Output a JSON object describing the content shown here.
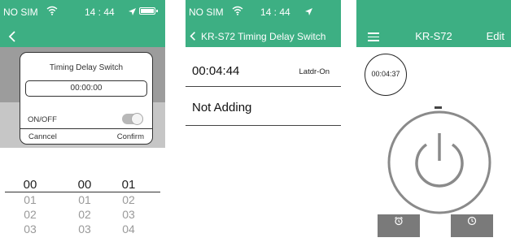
{
  "panel1": {
    "status": {
      "carrier": "NO SIM",
      "time": "14 : 44"
    },
    "dialog": {
      "title": "Timing Delay Switch",
      "time_value": "00:00:00",
      "onoff_label": "ON/OFF",
      "toggle_on": false,
      "cancel_label": "Canncel",
      "confirm_label": "Confirm"
    },
    "pickers": [
      {
        "selected": "00",
        "options": [
          "01",
          "02",
          "03"
        ]
      },
      {
        "selected": "00",
        "options": [
          "01",
          "02",
          "03"
        ]
      },
      {
        "selected": "01",
        "options": [
          "02",
          "03",
          "04"
        ]
      }
    ]
  },
  "panel2": {
    "status": {
      "carrier": "NO SIM",
      "time": "14 : 44"
    },
    "title": "KR-S72  Timing Delay Switch",
    "rows": [
      {
        "main": "00:04:44",
        "sub": "Latdr-On"
      },
      {
        "main": "Not Adding",
        "sub": ""
      }
    ]
  },
  "panel3": {
    "title": "KR-S72",
    "edit_label": "Edit",
    "timer_value": "00:04:37",
    "buttons": [
      {
        "icon": "alarm-clock-icon"
      },
      {
        "icon": "clock-icon"
      }
    ]
  },
  "colors": {
    "header": "#3daf83",
    "button_grey": "#7a7a7a",
    "ring": "#8a8a8a"
  }
}
